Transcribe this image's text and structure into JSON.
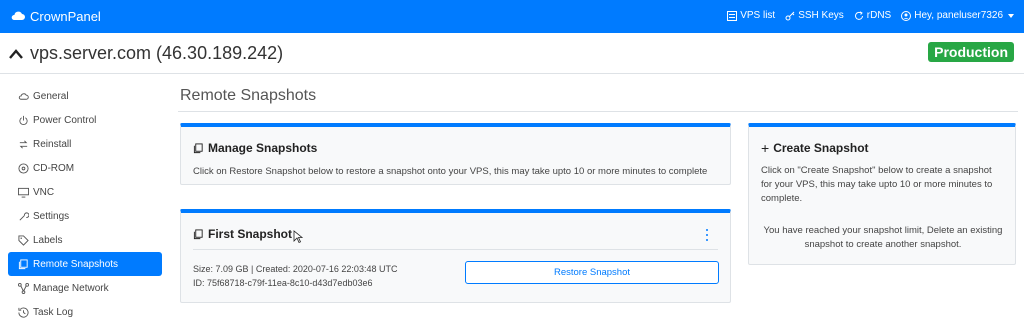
{
  "navbar": {
    "brand": "CrownPanel",
    "links": {
      "vps_list": "VPS list",
      "ssh_keys": "SSH Keys",
      "rdns": "rDNS",
      "user": "Hey, paneluser7326"
    }
  },
  "server": {
    "title": "vps.server.com (46.30.189.242)",
    "badge": "Production"
  },
  "sidebar": {
    "items": [
      {
        "label": "General",
        "icon": "cloud-icon"
      },
      {
        "label": "Power Control",
        "icon": "power-icon"
      },
      {
        "label": "Reinstall",
        "icon": "reinstall-icon"
      },
      {
        "label": "CD-ROM",
        "icon": "disc-icon"
      },
      {
        "label": "VNC",
        "icon": "monitor-icon"
      },
      {
        "label": "Settings",
        "icon": "wrench-icon"
      },
      {
        "label": "Labels",
        "icon": "tag-icon"
      },
      {
        "label": "Remote Snapshots",
        "icon": "copy-icon"
      },
      {
        "label": "Manage Network",
        "icon": "network-icon"
      },
      {
        "label": "Task Log",
        "icon": "log-icon"
      }
    ]
  },
  "main": {
    "title": "Remote Snapshots",
    "manage": {
      "title": "Manage Snapshots",
      "text": "Click on Restore Snapshot below to restore a snapshot onto your VPS, this may take upto 10 or more minutes to complete"
    },
    "snapshot": {
      "title": "First Snapshot",
      "meta": "Size: 7.09 GB | Created: 2020-07-16 22:03:48 UTC",
      "id": "ID: 75f68718-c79f-11ea-8c10-d43d7edb03e6",
      "restore_label": "Restore Snapshot"
    },
    "create": {
      "title": "Create Snapshot",
      "desc": "Click on \"Create Snapshot\" below to create a snapshot for your VPS, this may take upto 10 or more minutes to complete.",
      "limit": "You have reached your snapshot limit, Delete an existing snapshot to create another snapshot."
    }
  },
  "colors": {
    "primary": "#007bff",
    "success": "#28a745"
  }
}
